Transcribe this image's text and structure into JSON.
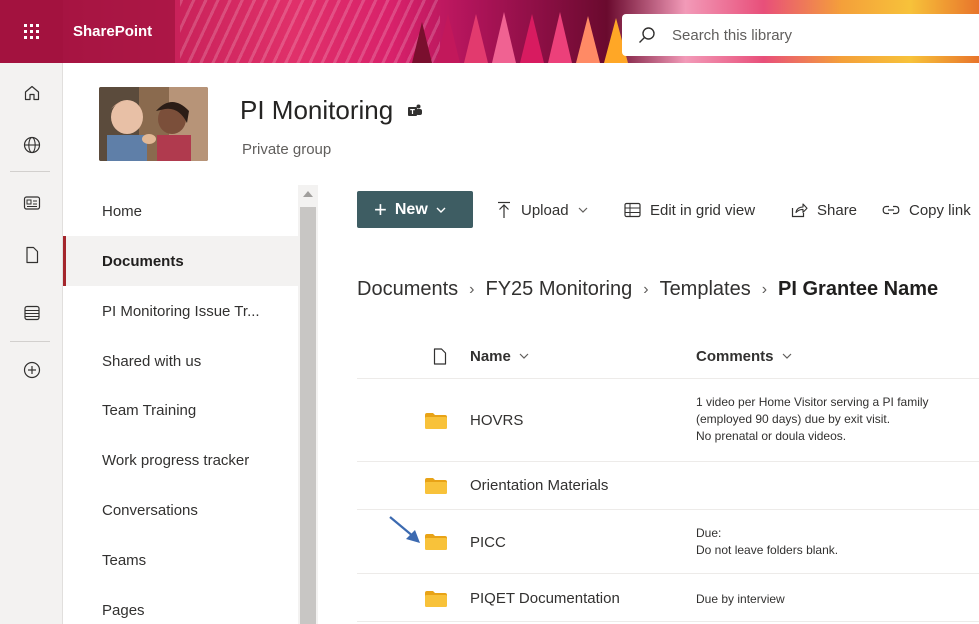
{
  "suite": {
    "brand": "SharePoint",
    "search_placeholder": "Search this library"
  },
  "appbar": {
    "icons": [
      "home-icon",
      "globe-icon",
      "news-icon",
      "file-icon",
      "list-icon",
      "add-icon"
    ]
  },
  "site": {
    "title": "PI Monitoring",
    "subtitle": "Private group"
  },
  "nav": {
    "items": [
      {
        "label": "Home"
      },
      {
        "label": "Documents",
        "active": true
      },
      {
        "label": "PI Monitoring Issue Tr..."
      },
      {
        "label": "Shared with us"
      },
      {
        "label": "Team Training"
      },
      {
        "label": "Work progress tracker"
      },
      {
        "label": "Conversations"
      },
      {
        "label": "Teams"
      },
      {
        "label": "Pages"
      }
    ]
  },
  "commandbar": {
    "new_label": "New",
    "upload_label": "Upload",
    "grid_label": "Edit in grid view",
    "share_label": "Share",
    "copylink_label": "Copy link"
  },
  "breadcrumb": {
    "items": [
      "Documents",
      "FY25 Monitoring",
      "Templates"
    ],
    "current": "PI Grantee Name"
  },
  "list": {
    "headers": {
      "name": "Name",
      "comments": "Comments"
    },
    "rows": [
      {
        "name": "HOVRS",
        "comments": [
          "1 video per Home Visitor serving a PI family",
          "(employed 90 days) due by exit visit.",
          "No prenatal or doula videos."
        ]
      },
      {
        "name": "Orientation Materials",
        "comments": []
      },
      {
        "name": "PICC",
        "comments": [
          "Due:",
          "Do not leave folders blank."
        ]
      },
      {
        "name": "PIQET Documentation",
        "comments": [
          "Due by interview"
        ]
      }
    ]
  },
  "colors": {
    "accent": "#a4262c",
    "new_button": "#3e5d63",
    "folder": "#f8c23a",
    "arrow": "#3c6ab0"
  }
}
